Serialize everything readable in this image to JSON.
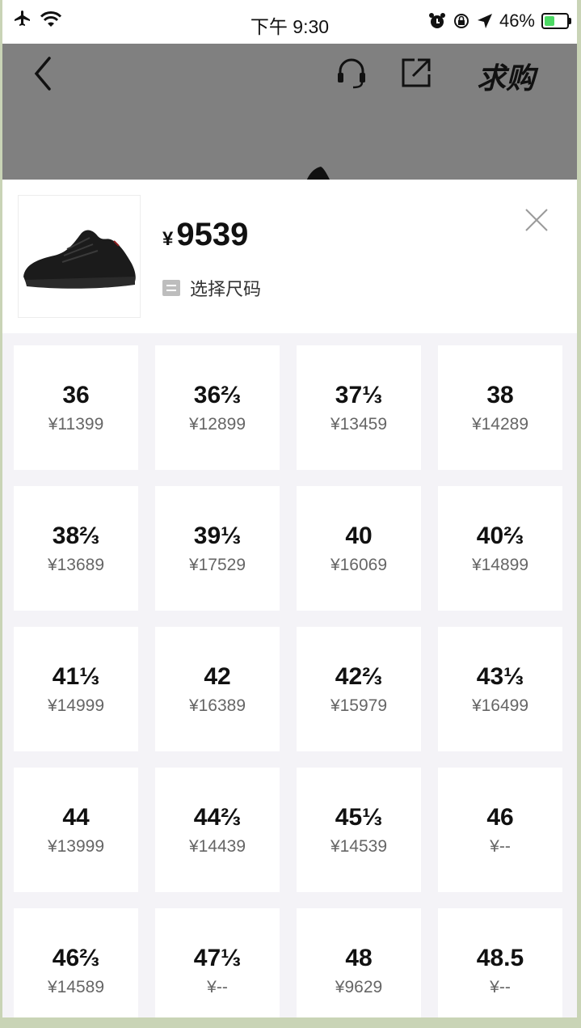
{
  "status_bar": {
    "time": "下午 9:30",
    "battery": "46%",
    "battery_level": 0.46
  },
  "header": {
    "buy_label": "求购"
  },
  "product": {
    "currency": "¥",
    "price": "9539",
    "size_hint": "选择尺码"
  },
  "sizes": [
    {
      "size": "36",
      "price": "¥11399"
    },
    {
      "size": "36⅔",
      "price": "¥12899"
    },
    {
      "size": "37⅓",
      "price": "¥13459"
    },
    {
      "size": "38",
      "price": "¥14289"
    },
    {
      "size": "38⅔",
      "price": "¥13689"
    },
    {
      "size": "39⅓",
      "price": "¥17529"
    },
    {
      "size": "40",
      "price": "¥16069"
    },
    {
      "size": "40⅔",
      "price": "¥14899"
    },
    {
      "size": "41⅓",
      "price": "¥14999"
    },
    {
      "size": "42",
      "price": "¥16389"
    },
    {
      "size": "42⅔",
      "price": "¥15979"
    },
    {
      "size": "43⅓",
      "price": "¥16499"
    },
    {
      "size": "44",
      "price": "¥13999"
    },
    {
      "size": "44⅔",
      "price": "¥14439"
    },
    {
      "size": "45⅓",
      "price": "¥14539"
    },
    {
      "size": "46",
      "price": "¥--"
    },
    {
      "size": "46⅔",
      "price": "¥14589"
    },
    {
      "size": "47⅓",
      "price": "¥--"
    },
    {
      "size": "48",
      "price": "¥9629"
    },
    {
      "size": "48.5",
      "price": "¥--"
    }
  ]
}
